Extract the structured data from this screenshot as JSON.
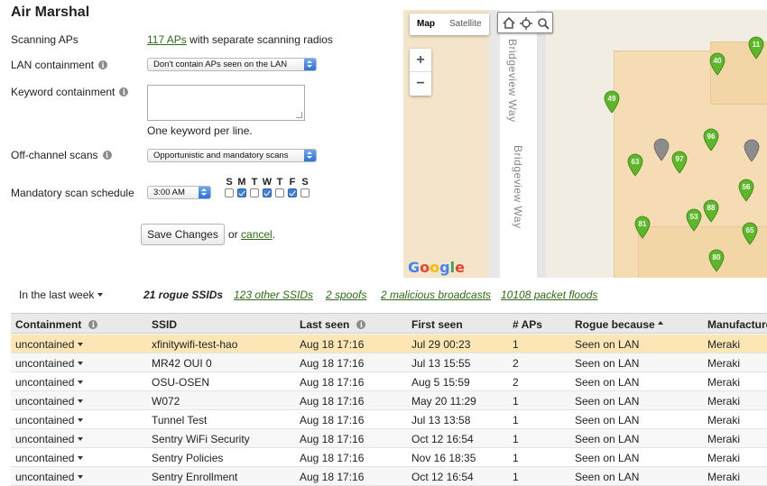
{
  "page": {
    "title": "Air Marshal"
  },
  "settings": {
    "scanning_aps": {
      "label": "Scanning APs",
      "link": "117 APs",
      "suffix": " with separate scanning radios"
    },
    "lan_containment": {
      "label": "LAN containment",
      "value": "Don't contain APs seen on the LAN"
    },
    "keyword_containment": {
      "label": "Keyword containment",
      "value": "",
      "hint": "One keyword per line."
    },
    "off_channel": {
      "label": "Off-channel scans",
      "value": "Opportunistic and mandatory scans"
    },
    "schedule": {
      "label": "Mandatory scan schedule",
      "time": "3:00 AM",
      "days": [
        {
          "letter": "S",
          "checked": false
        },
        {
          "letter": "M",
          "checked": true
        },
        {
          "letter": "T",
          "checked": false
        },
        {
          "letter": "W",
          "checked": true
        },
        {
          "letter": "T",
          "checked": false
        },
        {
          "letter": "F",
          "checked": true
        },
        {
          "letter": "S",
          "checked": false
        }
      ]
    },
    "save_label": "Save Changes",
    "or_text": " or ",
    "cancel_label": "cancel",
    "cancel_suffix": "."
  },
  "map": {
    "type_map": "Map",
    "type_satellite": "Satellite",
    "zoom_in": "+",
    "zoom_out": "−",
    "street_1": "Bridgeview Way",
    "street_2": "Bridgeview Way",
    "logo": "Google",
    "pins": [
      {
        "label": "11",
        "color": "#5cb828"
      },
      {
        "label": "40",
        "color": "#5cb828"
      },
      {
        "label": "49",
        "color": "#5cb828"
      },
      {
        "label": "",
        "color": "#8c8c8c"
      },
      {
        "label": "96",
        "color": "#5cb828"
      },
      {
        "label": "",
        "color": "#8c8c8c"
      },
      {
        "label": "63",
        "color": "#5cb828"
      },
      {
        "label": "97",
        "color": "#5cb828"
      },
      {
        "label": "56",
        "color": "#5cb828"
      },
      {
        "label": "88",
        "color": "#5cb828"
      },
      {
        "label": "81",
        "color": "#5cb828"
      },
      {
        "label": "53",
        "color": "#5cb828"
      },
      {
        "label": "65",
        "color": "#5cb828"
      },
      {
        "label": "80",
        "color": "#5cb828"
      }
    ]
  },
  "filter": {
    "label": "In the last week"
  },
  "tabs": [
    {
      "count": "21",
      "label": " rogue SSIDs"
    },
    {
      "count": "123",
      "label": " other SSIDs"
    },
    {
      "count": "2",
      "label": " spoofs"
    },
    {
      "count": "2",
      "label": " malicious broadcasts"
    },
    {
      "count": "10108",
      "label": " packet floods"
    }
  ],
  "table": {
    "columns": [
      "Containment",
      "SSID",
      "Last seen",
      "First seen",
      "# APs",
      "Rogue because",
      "Manufacturer"
    ],
    "rows": [
      {
        "containment": "uncontained",
        "ssid": "xfinitywifi-test-hao",
        "last_seen": "Aug 18 17:16",
        "first_seen": "Jul 29 00:23",
        "aps": "1",
        "rogue_because": "Seen on LAN",
        "manufacturer": "Meraki"
      },
      {
        "containment": "uncontained",
        "ssid": "MR42 OUI 0",
        "last_seen": "Aug 18 17:16",
        "first_seen": "Jul 13 15:55",
        "aps": "2",
        "rogue_because": "Seen on LAN",
        "manufacturer": "Meraki"
      },
      {
        "containment": "uncontained",
        "ssid": "OSU-OSEN",
        "last_seen": "Aug 18 17:16",
        "first_seen": "Aug 5 15:59",
        "aps": "2",
        "rogue_because": "Seen on LAN",
        "manufacturer": "Meraki"
      },
      {
        "containment": "uncontained",
        "ssid": "W072",
        "last_seen": "Aug 18 17:16",
        "first_seen": "May 20 11:29",
        "aps": "1",
        "rogue_because": "Seen on LAN",
        "manufacturer": "Meraki"
      },
      {
        "containment": "uncontained",
        "ssid": "Tunnel Test",
        "last_seen": "Aug 18 17:16",
        "first_seen": "Jul 13 13:58",
        "aps": "1",
        "rogue_because": "Seen on LAN",
        "manufacturer": "Meraki"
      },
      {
        "containment": "uncontained",
        "ssid": "Sentry WiFi Security",
        "last_seen": "Aug 18 17:16",
        "first_seen": "Oct 12 16:54",
        "aps": "1",
        "rogue_because": "Seen on LAN",
        "manufacturer": "Meraki"
      },
      {
        "containment": "uncontained",
        "ssid": "Sentry Policies",
        "last_seen": "Aug 18 17:16",
        "first_seen": "Nov 16 18:35",
        "aps": "1",
        "rogue_because": "Seen on LAN",
        "manufacturer": "Meraki"
      },
      {
        "containment": "uncontained",
        "ssid": "Sentry Enrollment",
        "last_seen": "Aug 18 17:16",
        "first_seen": "Oct 12 16:54",
        "aps": "1",
        "rogue_because": "Seen on LAN",
        "manufacturer": "Meraki"
      }
    ]
  }
}
